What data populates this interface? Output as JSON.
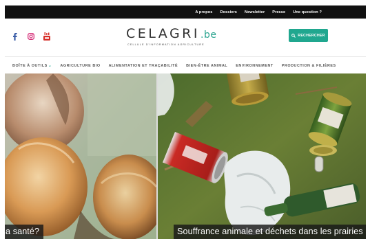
{
  "topbar": {
    "links": [
      "A propos",
      "Dossiers",
      "Newsletter",
      "Presse",
      "Une question ?"
    ]
  },
  "header": {
    "social_icons": [
      "facebook-icon",
      "instagram-icon",
      "youtube-icon"
    ],
    "logo": {
      "main": "CELAGRI",
      "tld": ".be",
      "tagline": "CELLULE D'INFORMATION AGRICULTURE"
    },
    "search_label": "RECHERCHER",
    "search_icon": "magnifier-icon"
  },
  "nav": {
    "items": [
      {
        "label": "BOÎTE À OUTILS",
        "has_dropdown": true
      },
      {
        "label": "AGRICULTURE BIO"
      },
      {
        "label": "ALIMENTATION ET TRAÇABILITÉ"
      },
      {
        "label": "BIEN-ÊTRE ANIMAL"
      },
      {
        "label": "ENVIRONNEMENT"
      },
      {
        "label": "PRODUCTION & FILIÈRES"
      }
    ]
  },
  "hero": {
    "slides": [
      {
        "caption": "a santé?"
      },
      {
        "caption": "Souffrance animale et déchets dans les prairies"
      }
    ]
  },
  "colors": {
    "accent": "#20a78f",
    "topbar": "#111111",
    "text": "#333333"
  }
}
